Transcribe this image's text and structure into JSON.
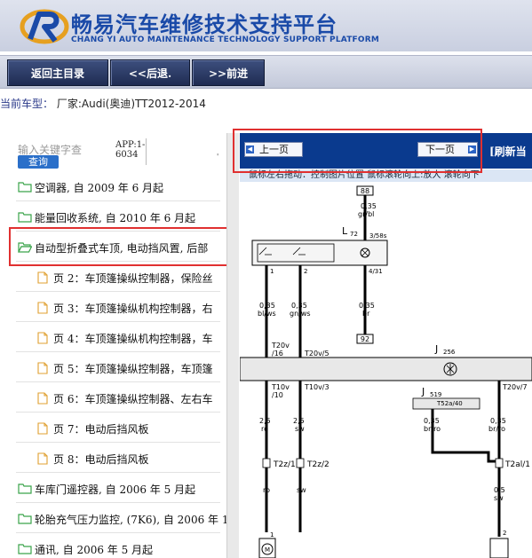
{
  "header": {
    "title_cn": "畅易汽车维修技术支持平台",
    "title_en": "CHANG YI AUTO MAINTENANCE TECHNOLOGY SUPPORT PLATFORM"
  },
  "nav": {
    "home": "返回主目录",
    "back": "<<后退.",
    "forward": ">>前进"
  },
  "current_model": {
    "label": "当前车型：",
    "value": "厂家:Audi(奥迪)TT2012-2014"
  },
  "search": {
    "placeholder": "输入关键字查",
    "button": "查询",
    "app_line1": "APP:1-",
    "app_line2": "6034",
    "mark": "'"
  },
  "tree": [
    {
      "label": "空调器, 自 2009 年 6 月起",
      "type": "folder"
    },
    {
      "label": "能量回收系统, 自 2010 年 6 月起",
      "type": "folder"
    },
    {
      "label": "自动型折叠式车顶, 电动挡风置, 后部",
      "type": "folder-open"
    },
    {
      "label": "页 2：车顶篷操纵控制器，保险丝",
      "type": "page"
    },
    {
      "label": "页 3：车顶篷操纵机构控制器，右",
      "type": "page"
    },
    {
      "label": "页 4：车顶篷操纵机构控制器，车",
      "type": "page"
    },
    {
      "label": "页 5：车顶篷操纵控制器，车顶篷",
      "type": "page"
    },
    {
      "label": "页 6：车顶篷操纵控制器、左右车",
      "type": "page"
    },
    {
      "label": "页 7：电动后挡风板",
      "type": "page"
    },
    {
      "label": "页 8：电动后挡风板",
      "type": "page"
    },
    {
      "label": "车库门遥控器, 自 2006 年 5 月起",
      "type": "folder"
    },
    {
      "label": "轮胎充气压力监控, (7K6), 自 2006 年 1",
      "type": "folder"
    },
    {
      "label": "通讯, 自 2006 年 5 月起",
      "type": "folder"
    }
  ],
  "viewer": {
    "prev": "上一页",
    "next": "下一页",
    "refresh": "[刷新当",
    "hint": "鼠标左右拖动：控制图片位置  鼠标滚轮向上:放大  滚轮向下"
  },
  "diagram": {
    "fuse": "88",
    "wire1": "0,35",
    "wire1c": "gr/bl",
    "relay": "L",
    "relay_sub": "72",
    "pin_a": "3/58s",
    "pin_b": "4/31",
    "pin_c": "1",
    "pin_d": "2",
    "w2": "0,35",
    "w2c": "bl/ws",
    "w3": "0,35",
    "w3c": "gn/ws",
    "w4": "0,35",
    "w4c": "br",
    "box92": "92",
    "t20v": "T20v",
    "t20v_s": "/16",
    "t20v5": "T20v/5",
    "j256": "J",
    "j256_sub": "256",
    "t10v": "T10v",
    "t10v_s": "/10",
    "t10v3": "T10v/3",
    "j519": "J",
    "j519_sub": "519",
    "t52a": "T52a/40",
    "t20v7": "T20v/7",
    "w5": "2,5",
    "w5c": "ro",
    "w6": "2,5",
    "w6c": "sw",
    "w7": "0,35",
    "w7c": "br/ro",
    "w8": "0,35",
    "w8c": "br/ro",
    "t2z1": "T2z/1",
    "t2z2": "T2z/2",
    "t2al": "T2al/1",
    "w9c": "ro",
    "w10c": "sw",
    "w11": "0,5",
    "w11c": "sw",
    "m1": "1",
    "m2": "2"
  },
  "colors": {
    "accent": "#0a3a8e",
    "highlight": "#e03030",
    "brand": "#1a4aa8"
  }
}
